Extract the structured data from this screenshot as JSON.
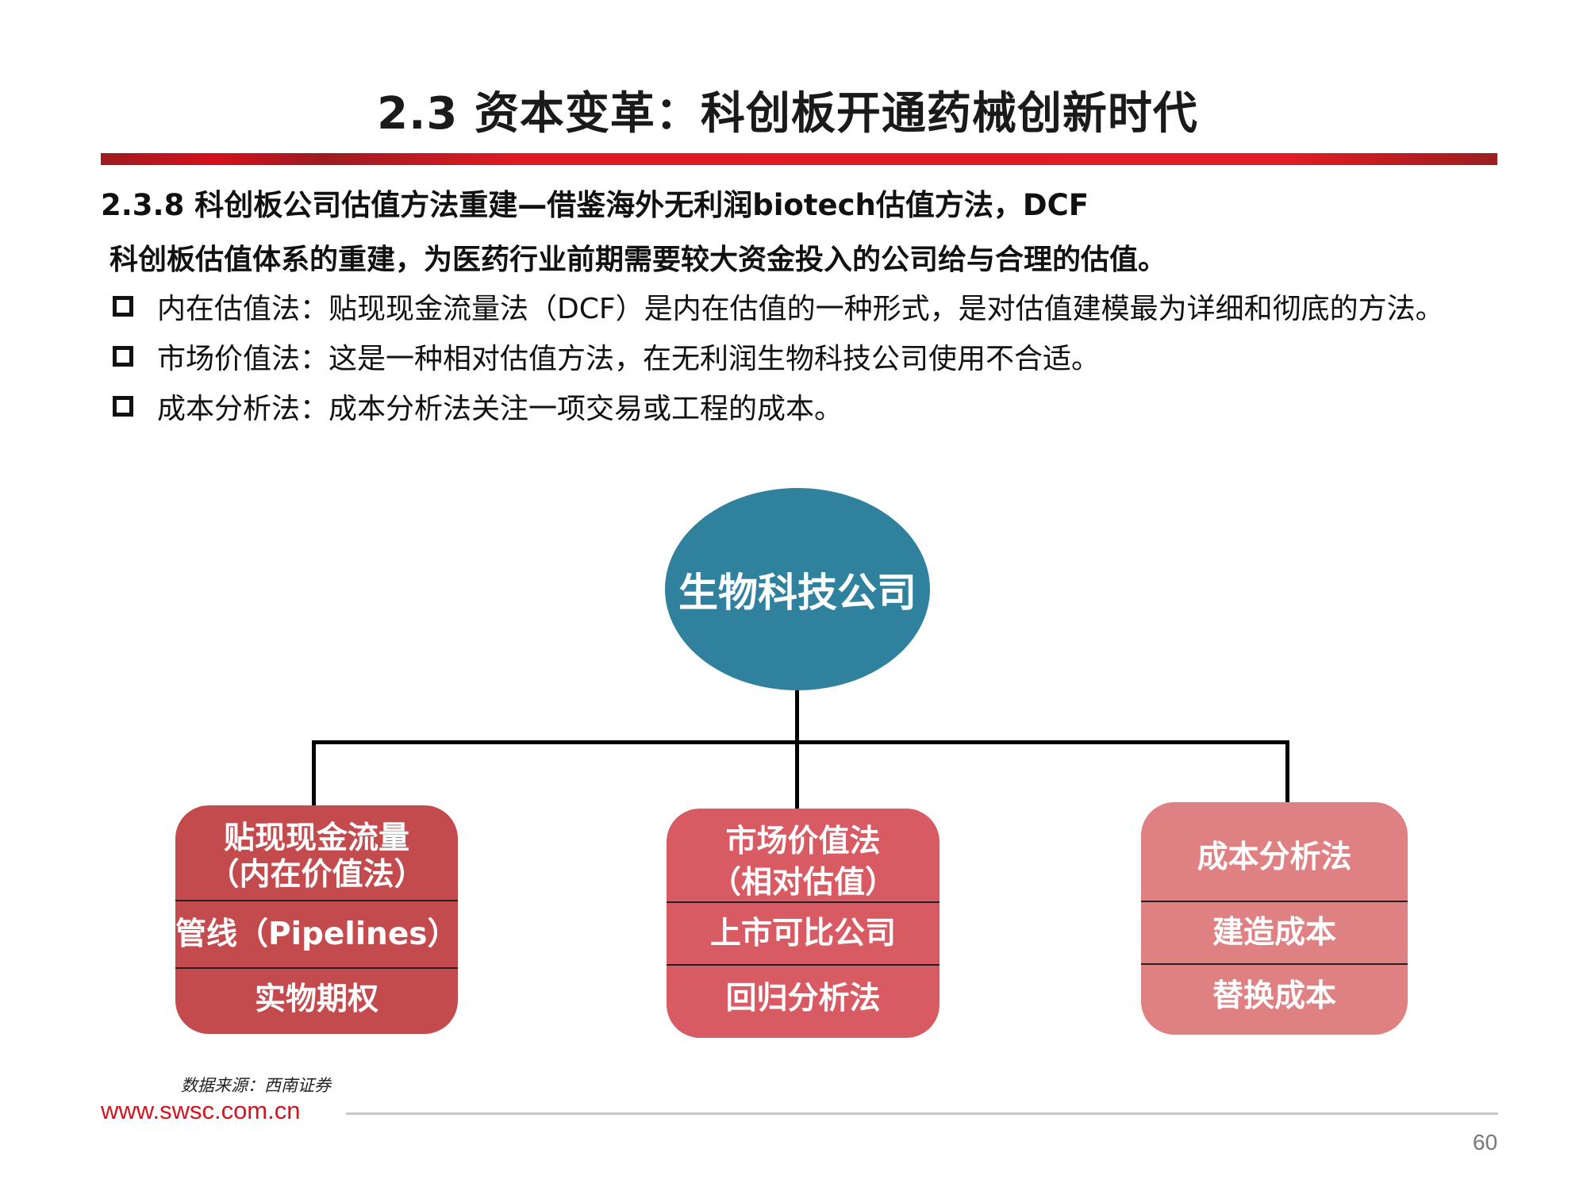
{
  "header": {
    "title": "2.3 资本变革：科创板开通药械创新时代"
  },
  "content": {
    "subtitle": "2.3.8 科创板公司估值方法重建—借鉴海外无利润biotech估值方法，DCF",
    "lead": "科创板估值体系的重建，为医药行业前期需要较大资金投入的公司给与合理的估值。",
    "bullets": [
      "内在估值法：贴现现金流量法（DCF）是内在估值的一种形式，是对估值建模最为详细和彻底的方法。",
      "市场价值法：这是一种相对估值方法，在无利润生物科技公司使用不合适。",
      "成本分析法：成本分析法关注一项交易或工程的成本。"
    ]
  },
  "diagram": {
    "root": "生物科技公司",
    "branches": [
      {
        "heading_line1": "贴现现金流量",
        "heading_line2": "（内在价值法）",
        "items": [
          "管线（Pipelines）",
          "实物期权"
        ],
        "color": "#c34b4e"
      },
      {
        "heading_line1": "市场价值法",
        "heading_line2": "（相对估值）",
        "items": [
          "上市可比公司",
          "回归分析法"
        ],
        "color": "#d85a62"
      },
      {
        "heading_line1": "成本分析法",
        "heading_line2": "",
        "items": [
          "建造成本",
          "替换成本"
        ],
        "color": "#df8082"
      }
    ],
    "ellipse_color": "#2f819d"
  },
  "footer": {
    "source": "数据来源：西南证券",
    "website": "www.swsc.com.cn",
    "page_number": "60"
  },
  "colors": {
    "accent_red": "#e11c24",
    "website_red": "#d0161f"
  }
}
